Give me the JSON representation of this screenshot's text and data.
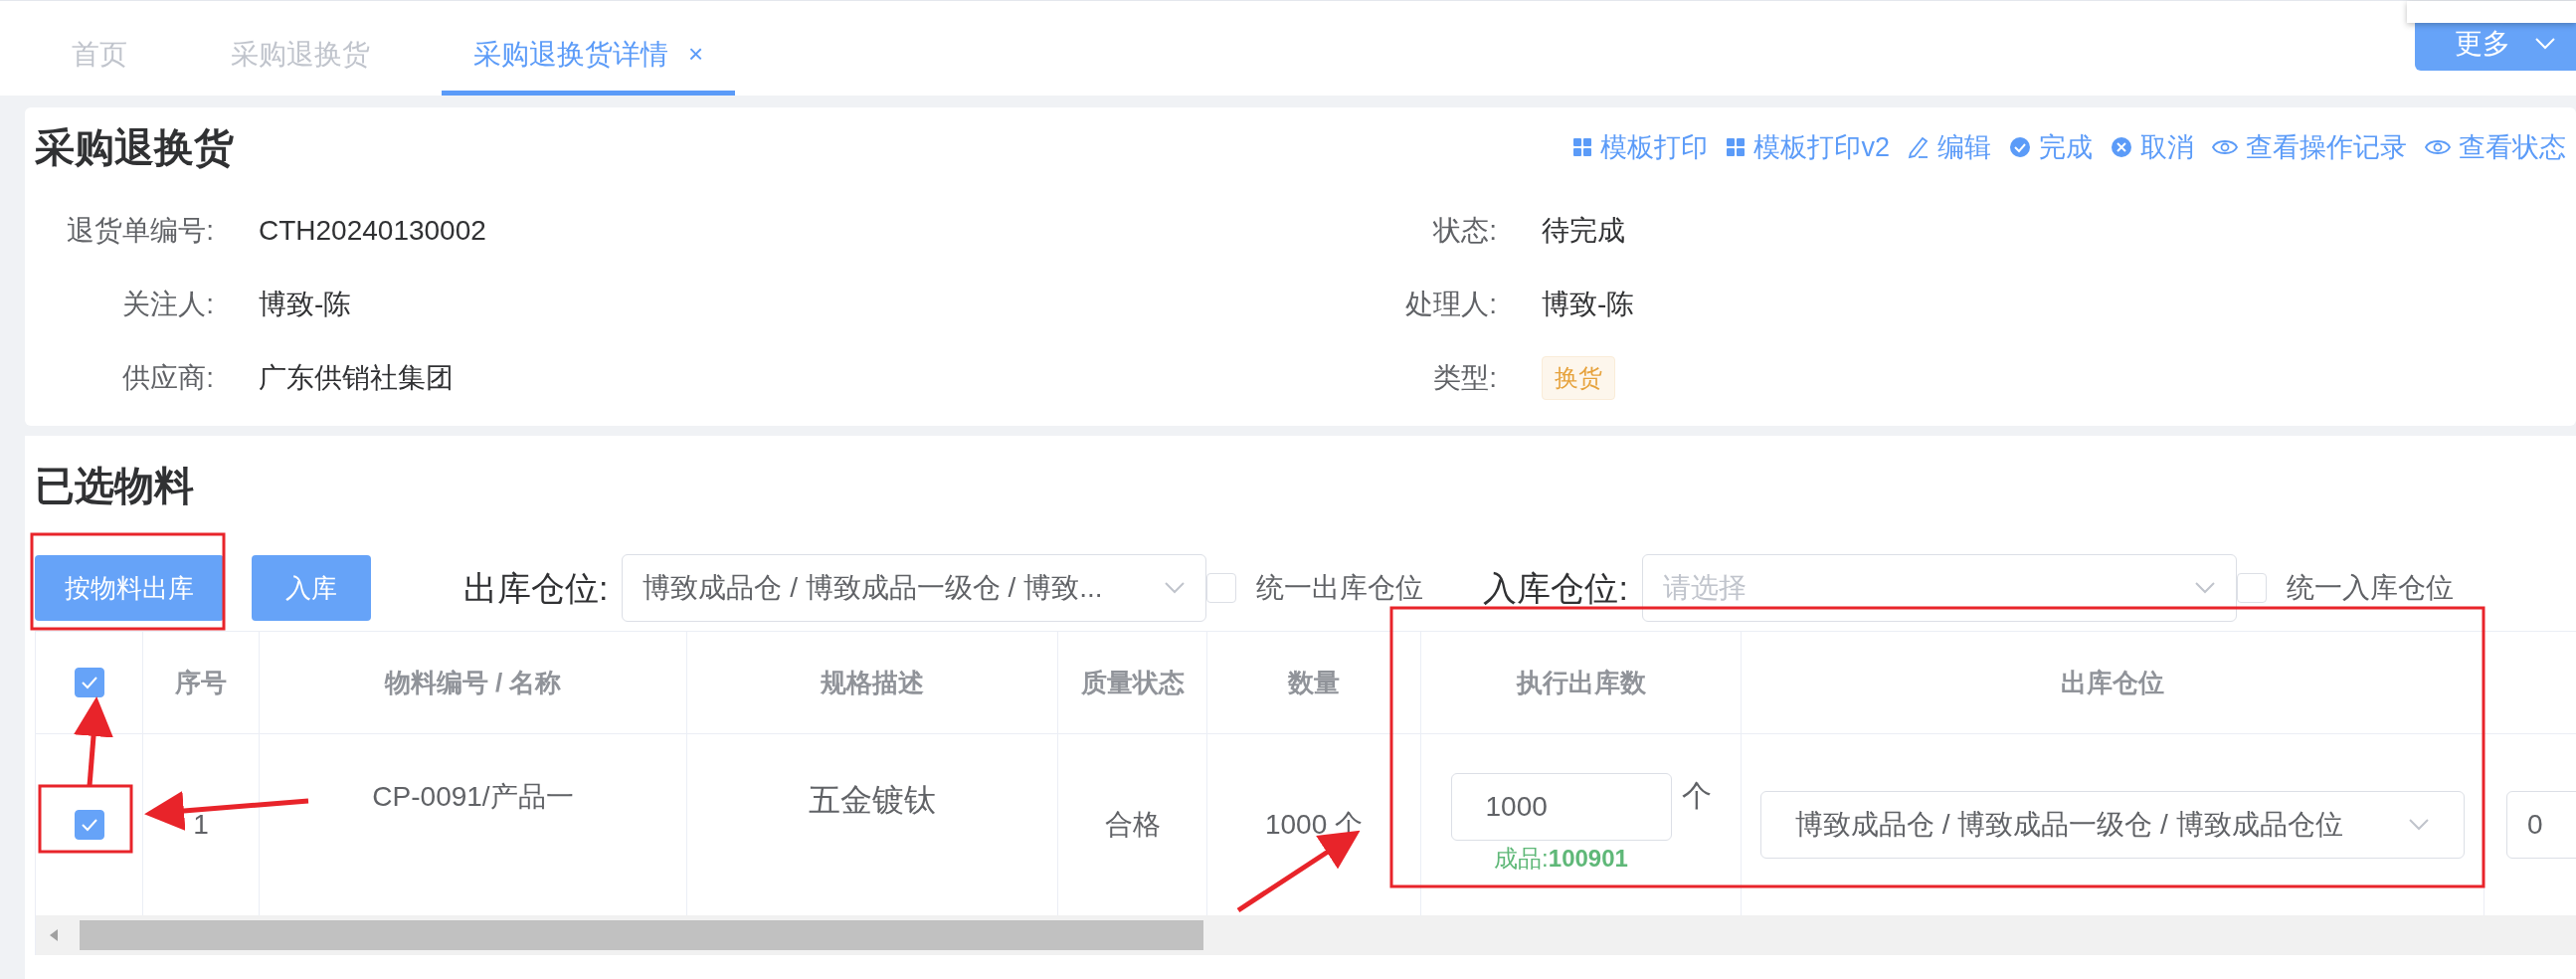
{
  "tabs": [
    {
      "label": "首页",
      "selected": false
    },
    {
      "label": "采购退换货",
      "selected": false
    },
    {
      "label": "采购退换货详情",
      "selected": true,
      "close_glyph": "×"
    }
  ],
  "more_button": {
    "label": "更多"
  },
  "detail": {
    "title": "采购退换货",
    "actions": [
      {
        "label": "模板打印",
        "kind": "grid"
      },
      {
        "label": "模板打印v2",
        "kind": "grid"
      },
      {
        "label": "编辑",
        "kind": "edit"
      },
      {
        "label": "完成",
        "kind": "check"
      },
      {
        "label": "取消",
        "kind": "cancel"
      },
      {
        "label": "查看操作记录",
        "kind": "eye"
      },
      {
        "label": "查看状态",
        "kind": "eye"
      }
    ],
    "fields_left": [
      {
        "label": "退货单编号:",
        "value": "CTH20240130002",
        "kind": "text"
      },
      {
        "label": "关注人:",
        "value": "博致-陈",
        "kind": "text"
      },
      {
        "label": "供应商:",
        "value": "广东供销社集团",
        "kind": "text"
      }
    ],
    "fields_right": [
      {
        "label": "状态:",
        "value": "待完成",
        "kind": "text"
      },
      {
        "label": "处理人:",
        "value": "博致-陈",
        "kind": "text"
      },
      {
        "label": "类型:",
        "value": "换货",
        "kind": "tag"
      }
    ]
  },
  "materials": {
    "title": "已选物料",
    "buttons": [
      "按物料出库",
      "入库"
    ],
    "out_location": {
      "label": "出库仓位:",
      "value": "博致成品仓 / 博致成品一级仓 / 博致..."
    },
    "unify_out": {
      "label": "统一出库仓位",
      "checked": false
    },
    "in_location": {
      "label": "入库仓位:",
      "placeholder": "请选择"
    },
    "unify_in": {
      "label": "统一入库仓位",
      "checked": false
    },
    "table": {
      "header_checked": true,
      "columns": [
        "序号",
        "物料编号 / 名称",
        "规格描述",
        "质量状态",
        "数量",
        "执行出库数",
        "出库仓位"
      ],
      "rows": [
        {
          "selected": true,
          "index": "1",
          "code": "CP-0091/产品一",
          "spec": "五金镀钛",
          "quality": "合格",
          "quantity": "1000 个",
          "exec_qty": "1000",
          "unit": "个",
          "stock": "成品:**100901**",
          "location": "博致成品仓 / 博致成品一级仓 / 博致成品仓位",
          "column_9": "0"
        }
      ]
    }
  }
}
